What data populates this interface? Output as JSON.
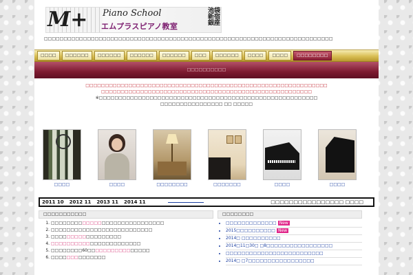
{
  "header": {
    "logo_mark": "M+",
    "logo_script": "Piano School",
    "logo_kana": "エムプラスピアノ教室",
    "logo_locations": [
      "池袋",
      "新宿",
      "銀座"
    ],
    "tagline": "□□□□□□□□□□□□□□□□□□□□□□□□□□□□□□□□□□□□□□□□□□□□□□□□□□□□□□□□□□□□□□□□□□□□□□□□□□"
  },
  "nav": {
    "items": [
      "□□□□",
      "□□□□□□",
      "□□□□□□",
      "□□□□□□",
      "□□□□□□",
      "□□□",
      "□□□□□□",
      "□□□□",
      "□□□□",
      "□□□□□□□□"
    ]
  },
  "banner": {
    "text": "□□□□□□□□□□"
  },
  "notice": {
    "line1": "□□□□□□□□□□□□□□□□□□□□□□□□□□□□□□□□□□□□□□□□□□□□□□□□□□□□□□□□□□□□□□",
    "line2": "□□□□□□□□□□□□□□□□□□□□□□□□□□□□□□□□□□□□□□□□□□□□□□□□□□□□□□",
    "line3": "※□□□□□□□□□□□□□□□□□□□□□□□□□□□□□□□□□□□□□□□□□□□□□□□□□□□□□□□□",
    "line4": "□□□□□□□□□□□□□□□□ □□ □□□□□"
  },
  "photos": [
    {
      "caption": "□□□□"
    },
    {
      "caption": "□□□□"
    },
    {
      "caption": "□□□□□□□□"
    },
    {
      "caption": "□□□□□□□"
    },
    {
      "caption": "□□□□"
    },
    {
      "caption": "□□□□"
    }
  ],
  "history": {
    "years": [
      "2011 10",
      "2012 11",
      "2013 11",
      "2014 11"
    ],
    "right_text": "□□□□□□□□□□□□□□□□ □□□□"
  },
  "left_box": {
    "heading": "□□□□□□□□□□□",
    "items": [
      {
        "pre": "□□□□□□□□",
        "hl": "□□□□□",
        "post": "□□□□□□□□□□□□□□□□"
      },
      {
        "pre": "□□□□□□□□□□□□□□□□□□□□□□□□□",
        "hl": "",
        "post": "□"
      },
      {
        "pre": "□□□□",
        "hl": "□□□□□",
        "post": "□□□□□□□□□"
      },
      {
        "pre": "",
        "hl": "□□□□□□□□□□",
        "post": "□□□□□□□□□□□□□"
      },
      {
        "pre": "□□□□□□□□60□□",
        "hl": "□□□□□□□□□",
        "post": "□□□□□"
      },
      {
        "pre": "□□□□",
        "hl": "□□□",
        "post": "□□□□□□□"
      }
    ]
  },
  "right_box": {
    "heading": "□□□□□□□□",
    "new_label": "New",
    "items": [
      {
        "text": "□□□□□□□□□□□□□",
        "new": true
      },
      {
        "text": "2015□□□□□□□□□□",
        "new": true
      },
      {
        "text": "2014□ □□□□□□□□□□",
        "new": false
      },
      {
        "text": "2014□11□30□ □8□□□□□□□□□□□□□□□□□",
        "new": false
      },
      {
        "text": "□□□□□□□□□□□□□□□□□□□□□□□□□",
        "new": false
      },
      {
        "text": "2014□ □7□□□□□□□□□□□□□□□□□",
        "new": false
      }
    ]
  },
  "colors": {
    "accent_wine": "#7d1a30",
    "gold": "#d9bf55",
    "link_blue": "#1a3ea0",
    "highlight_pink": "#d63b7a",
    "new_badge": "#e0278a"
  }
}
